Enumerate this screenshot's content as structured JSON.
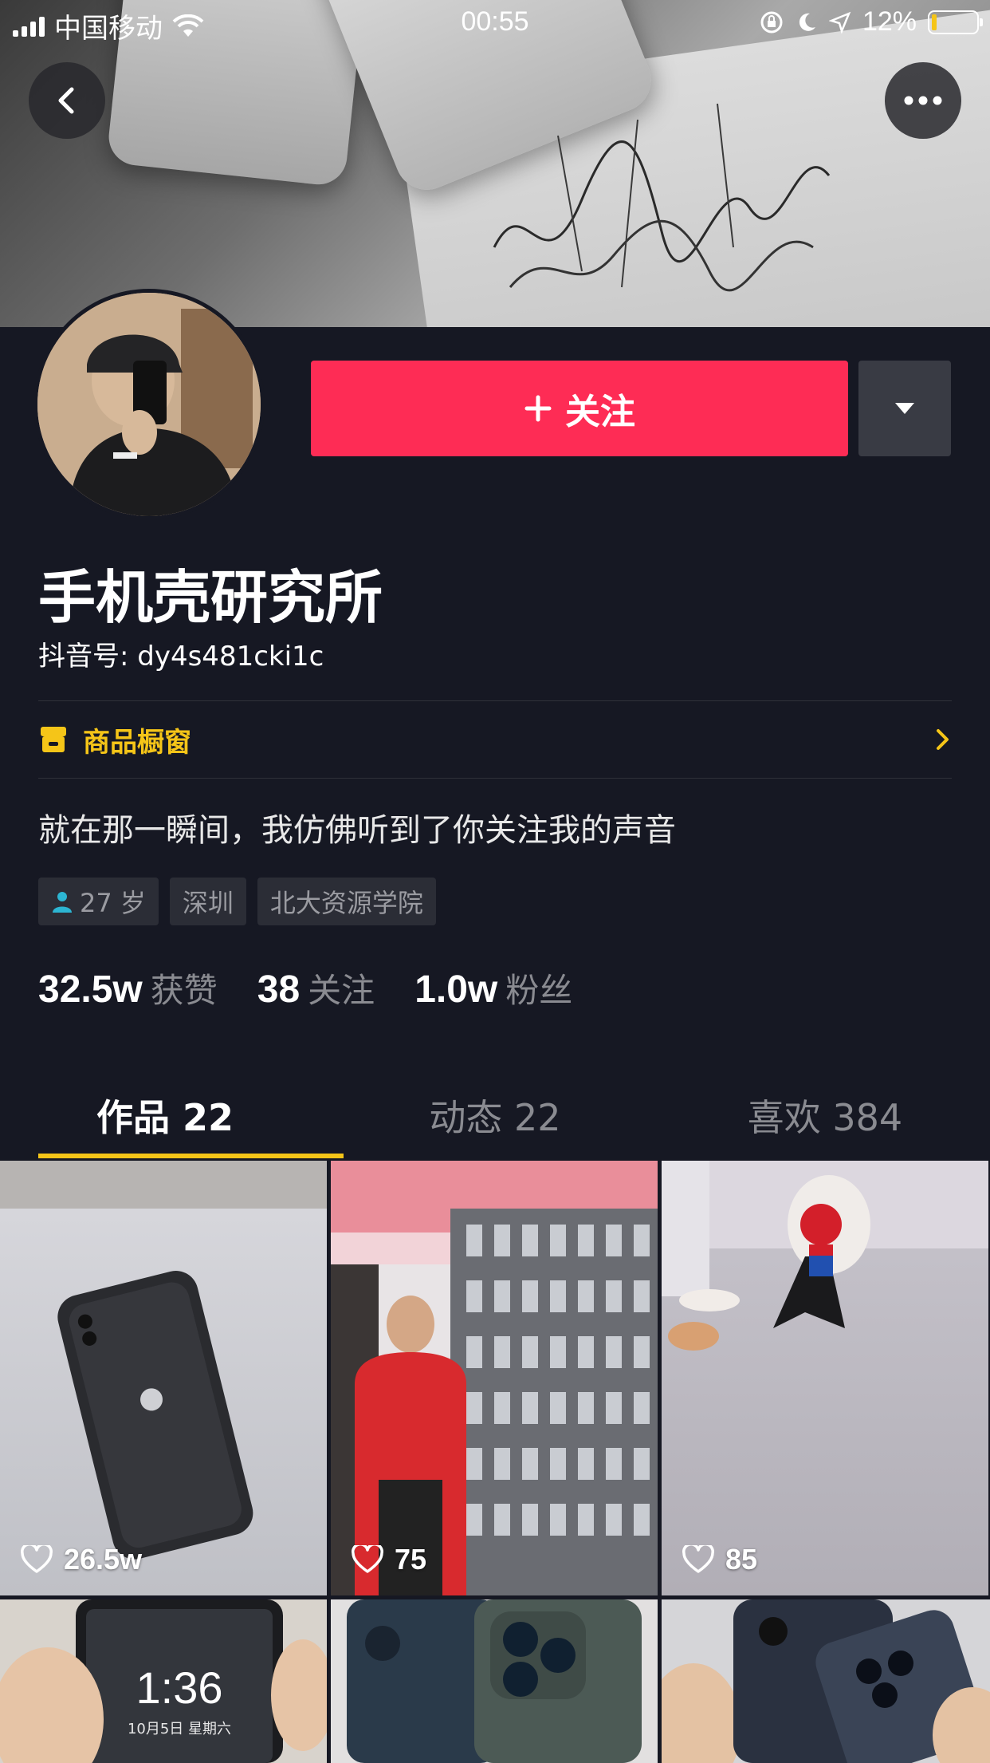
{
  "status_bar": {
    "carrier": "中国移动",
    "time": "00:55",
    "battery": "12%",
    "battery_level": 0.12
  },
  "header": {
    "back_icon": "chevron-left-icon",
    "more_icon": "more-horizontal-icon"
  },
  "profile": {
    "follow_label": "关注",
    "name": "手机壳研究所",
    "douyin_id": "抖音号: dy4s481cki1c",
    "shop_label": "商品橱窗",
    "bio": "就在那一瞬间，我仿佛听到了你关注我的声音",
    "tags": [
      {
        "label": "27 岁",
        "icon": "user-icon"
      },
      {
        "label": "深圳"
      },
      {
        "label": "北大资源学院"
      }
    ],
    "stats": [
      {
        "value": "32.5w",
        "label": "获赞"
      },
      {
        "value": "38",
        "label": "关注"
      },
      {
        "value": "1.0w",
        "label": "粉丝"
      }
    ]
  },
  "tabs": [
    {
      "label": "作品 22",
      "active": true
    },
    {
      "label": "动态 22",
      "active": false
    },
    {
      "label": "喜欢 384",
      "active": false
    }
  ],
  "videos": [
    {
      "likes": "26.5w"
    },
    {
      "likes": "75"
    },
    {
      "likes": "85"
    }
  ],
  "lock_screen_preview": {
    "time": "1:36",
    "date": "10月5日 星期六"
  },
  "colors": {
    "background": "#161823",
    "follow_button": "#fe2c55",
    "accent_yellow": "#f5c518"
  }
}
